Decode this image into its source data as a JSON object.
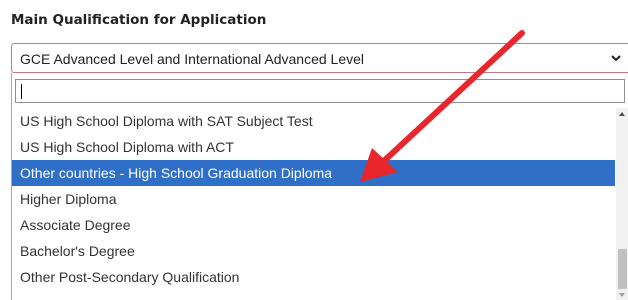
{
  "form": {
    "label": "Main Qualification for Application",
    "selected_value": "GCE Advanced Level and International Advanced Level",
    "search_value": ""
  },
  "dropdown": {
    "options": [
      {
        "label": "US High School Diploma with SAT Subject Test",
        "highlighted": false
      },
      {
        "label": "US High School Diploma with ACT",
        "highlighted": false
      },
      {
        "label": "Other countries - High School Graduation Diploma",
        "highlighted": true
      },
      {
        "label": "Higher Diploma",
        "highlighted": false
      },
      {
        "label": "Associate Degree",
        "highlighted": false
      },
      {
        "label": "Bachelor's Degree",
        "highlighted": false
      },
      {
        "label": "Other Post-Secondary Qualification",
        "highlighted": false
      }
    ]
  },
  "icons": {
    "select_chevron": "chevron-down-icon",
    "annotation": "red-arrow-icon"
  },
  "colors": {
    "highlight": "#2f6fc8",
    "select_border": "#c47a84",
    "annotation_arrow": "#e8262c"
  }
}
